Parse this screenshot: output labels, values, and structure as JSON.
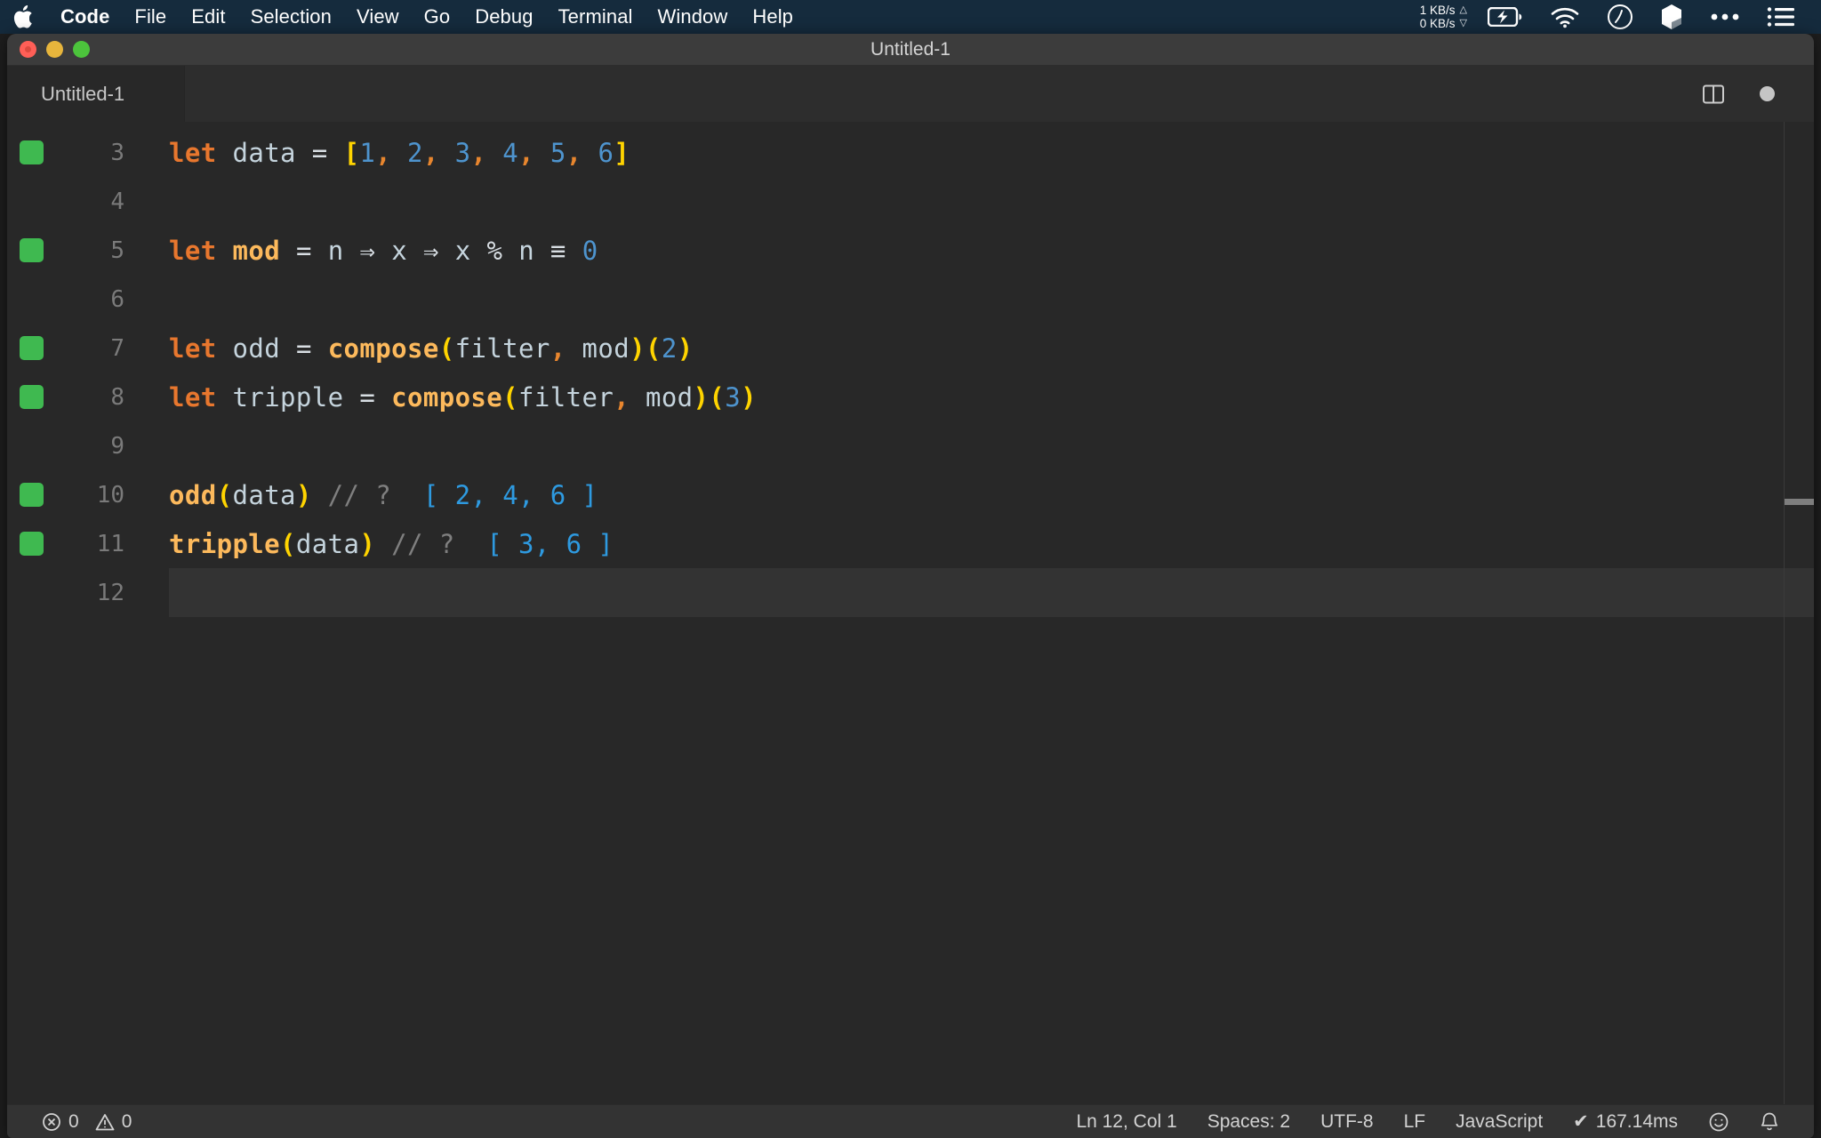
{
  "menubar": {
    "apple_icon": "apple-logo-icon",
    "items": [
      {
        "label": "Code",
        "bold": true
      },
      {
        "label": "File",
        "bold": false
      },
      {
        "label": "Edit",
        "bold": false
      },
      {
        "label": "Selection",
        "bold": false
      },
      {
        "label": "View",
        "bold": false
      },
      {
        "label": "Go",
        "bold": false
      },
      {
        "label": "Debug",
        "bold": false
      },
      {
        "label": "Terminal",
        "bold": false
      },
      {
        "label": "Window",
        "bold": false
      },
      {
        "label": "Help",
        "bold": false
      }
    ],
    "network": {
      "upload": "1 KB/s",
      "download": "0 KB/s",
      "up_arrow": "△",
      "down_arrow": "▽"
    },
    "status_icons": [
      "battery-charging-icon",
      "wifi-icon",
      "speedometer-icon",
      "cube-icon",
      "ellipsis-icon",
      "list-icon"
    ],
    "background_color": "#152b3d"
  },
  "window": {
    "title": "Untitled-1",
    "traffic_lights": [
      "close-button",
      "minimize-button",
      "zoom-button"
    ]
  },
  "tabbar": {
    "tabs": [
      {
        "label": "Untitled-1",
        "active": true,
        "dirty": true
      }
    ],
    "actions": [
      {
        "name": "split-editor-icon",
        "label": "Split Editor"
      },
      {
        "name": "unsaved-indicator",
        "label": "Unsaved changes"
      }
    ]
  },
  "editor": {
    "background_color": "#282828",
    "current_line": 12,
    "gutter_marker_color": "#3fb950",
    "lines": [
      {
        "number": "3",
        "marked": true,
        "current": false,
        "tokens": [
          {
            "t": "let",
            "c": "t-kw"
          },
          {
            "t": " ",
            "c": "t-plain"
          },
          {
            "t": "data",
            "c": "t-var"
          },
          {
            "t": " ",
            "c": "t-plain"
          },
          {
            "t": "=",
            "c": "t-op"
          },
          {
            "t": " ",
            "c": "t-plain"
          },
          {
            "t": "[",
            "c": "t-bracket"
          },
          {
            "t": "1",
            "c": "t-num"
          },
          {
            "t": ",",
            "c": "t-comma"
          },
          {
            "t": " ",
            "c": "t-plain"
          },
          {
            "t": "2",
            "c": "t-num"
          },
          {
            "t": ",",
            "c": "t-comma"
          },
          {
            "t": " ",
            "c": "t-plain"
          },
          {
            "t": "3",
            "c": "t-num"
          },
          {
            "t": ",",
            "c": "t-comma"
          },
          {
            "t": " ",
            "c": "t-plain"
          },
          {
            "t": "4",
            "c": "t-num"
          },
          {
            "t": ",",
            "c": "t-comma"
          },
          {
            "t": " ",
            "c": "t-plain"
          },
          {
            "t": "5",
            "c": "t-num"
          },
          {
            "t": ",",
            "c": "t-comma"
          },
          {
            "t": " ",
            "c": "t-plain"
          },
          {
            "t": "6",
            "c": "t-num"
          },
          {
            "t": "]",
            "c": "t-bracket"
          }
        ]
      },
      {
        "number": "4",
        "marked": false,
        "current": false,
        "tokens": []
      },
      {
        "number": "5",
        "marked": true,
        "current": false,
        "tokens": [
          {
            "t": "let",
            "c": "t-kw"
          },
          {
            "t": " ",
            "c": "t-plain"
          },
          {
            "t": "mod",
            "c": "t-fn"
          },
          {
            "t": " ",
            "c": "t-plain"
          },
          {
            "t": "=",
            "c": "t-op"
          },
          {
            "t": " ",
            "c": "t-plain"
          },
          {
            "t": "n",
            "c": "t-var"
          },
          {
            "t": " ",
            "c": "t-plain"
          },
          {
            "t": "⇒",
            "c": "t-op"
          },
          {
            "t": " ",
            "c": "t-plain"
          },
          {
            "t": "x",
            "c": "t-var"
          },
          {
            "t": " ",
            "c": "t-plain"
          },
          {
            "t": "⇒",
            "c": "t-op"
          },
          {
            "t": " ",
            "c": "t-plain"
          },
          {
            "t": "x",
            "c": "t-var"
          },
          {
            "t": " ",
            "c": "t-plain"
          },
          {
            "t": "%",
            "c": "t-op"
          },
          {
            "t": " ",
            "c": "t-plain"
          },
          {
            "t": "n",
            "c": "t-var"
          },
          {
            "t": " ",
            "c": "t-plain"
          },
          {
            "t": "≡",
            "c": "t-op"
          },
          {
            "t": " ",
            "c": "t-plain"
          },
          {
            "t": "0",
            "c": "t-num"
          }
        ]
      },
      {
        "number": "6",
        "marked": false,
        "current": false,
        "tokens": []
      },
      {
        "number": "7",
        "marked": true,
        "current": false,
        "tokens": [
          {
            "t": "let",
            "c": "t-kw"
          },
          {
            "t": " ",
            "c": "t-plain"
          },
          {
            "t": "odd",
            "c": "t-var"
          },
          {
            "t": " ",
            "c": "t-plain"
          },
          {
            "t": "=",
            "c": "t-op"
          },
          {
            "t": " ",
            "c": "t-plain"
          },
          {
            "t": "compose",
            "c": "t-fn"
          },
          {
            "t": "(",
            "c": "t-paren"
          },
          {
            "t": "filter",
            "c": "t-var"
          },
          {
            "t": ",",
            "c": "t-comma"
          },
          {
            "t": " ",
            "c": "t-plain"
          },
          {
            "t": "mod",
            "c": "t-var"
          },
          {
            "t": ")",
            "c": "t-paren"
          },
          {
            "t": "(",
            "c": "t-paren"
          },
          {
            "t": "2",
            "c": "t-num"
          },
          {
            "t": ")",
            "c": "t-paren"
          }
        ]
      },
      {
        "number": "8",
        "marked": true,
        "current": false,
        "tokens": [
          {
            "t": "let",
            "c": "t-kw"
          },
          {
            "t": " ",
            "c": "t-plain"
          },
          {
            "t": "tripple",
            "c": "t-var"
          },
          {
            "t": " ",
            "c": "t-plain"
          },
          {
            "t": "=",
            "c": "t-op"
          },
          {
            "t": " ",
            "c": "t-plain"
          },
          {
            "t": "compose",
            "c": "t-fn"
          },
          {
            "t": "(",
            "c": "t-paren"
          },
          {
            "t": "filter",
            "c": "t-var"
          },
          {
            "t": ",",
            "c": "t-comma"
          },
          {
            "t": " ",
            "c": "t-plain"
          },
          {
            "t": "mod",
            "c": "t-var"
          },
          {
            "t": ")",
            "c": "t-paren"
          },
          {
            "t": "(",
            "c": "t-paren"
          },
          {
            "t": "3",
            "c": "t-num"
          },
          {
            "t": ")",
            "c": "t-paren"
          }
        ]
      },
      {
        "number": "9",
        "marked": false,
        "current": false,
        "tokens": []
      },
      {
        "number": "10",
        "marked": true,
        "current": false,
        "tokens": [
          {
            "t": "odd",
            "c": "t-fn"
          },
          {
            "t": "(",
            "c": "t-paren"
          },
          {
            "t": "data",
            "c": "t-var"
          },
          {
            "t": ")",
            "c": "t-paren"
          },
          {
            "t": " ",
            "c": "t-plain"
          },
          {
            "t": "//",
            "c": "t-cmt"
          },
          {
            "t": " ",
            "c": "t-plain"
          },
          {
            "t": "?",
            "c": "t-cmt"
          },
          {
            "t": "  ",
            "c": "t-plain"
          },
          {
            "t": "[ 2, 4, 6 ]",
            "c": "t-res"
          }
        ]
      },
      {
        "number": "11",
        "marked": true,
        "current": false,
        "tokens": [
          {
            "t": "tripple",
            "c": "t-fn"
          },
          {
            "t": "(",
            "c": "t-paren"
          },
          {
            "t": "data",
            "c": "t-var"
          },
          {
            "t": ")",
            "c": "t-paren"
          },
          {
            "t": " ",
            "c": "t-plain"
          },
          {
            "t": "//",
            "c": "t-cmt"
          },
          {
            "t": " ",
            "c": "t-plain"
          },
          {
            "t": "?",
            "c": "t-cmt"
          },
          {
            "t": "  ",
            "c": "t-plain"
          },
          {
            "t": "[ 3, 6 ]",
            "c": "t-res"
          }
        ]
      },
      {
        "number": "12",
        "marked": false,
        "current": true,
        "tokens": []
      }
    ]
  },
  "statusbar": {
    "errors": "0",
    "warnings": "0",
    "cursor_position": "Ln 12, Col 1",
    "indentation": "Spaces: 2",
    "encoding": "UTF-8",
    "line_ending": "LF",
    "language": "JavaScript",
    "runtime": "167.14ms",
    "runtime_check": "✔",
    "feedback_icon": "smiley-icon",
    "notifications_icon": "bell-icon",
    "background_color": "#333333"
  }
}
